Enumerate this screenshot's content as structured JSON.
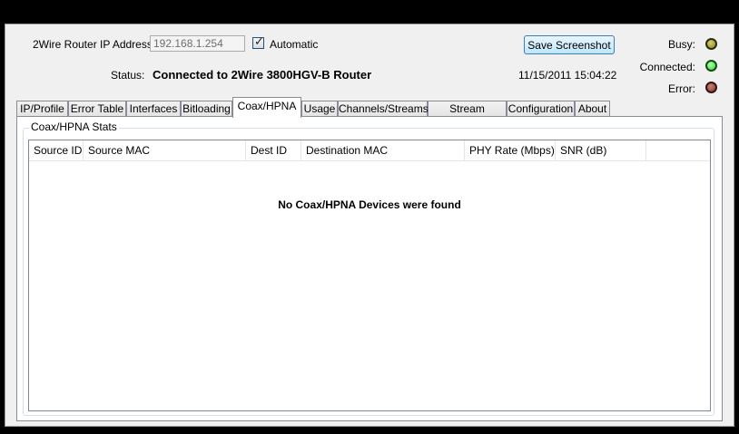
{
  "header": {
    "ip_label": "2Wire Router IP Address:",
    "ip_value": "192.168.1.254",
    "automatic_label": "Automatic",
    "automatic_checked": true,
    "status_label": "Status:",
    "status_text": "Connected to 2Wire 3800HGV-B Router",
    "save_label": "Save Screenshot",
    "timestamp": "11/15/2011 15:04:22"
  },
  "indicators": {
    "busy": {
      "label": "Busy:",
      "color": "#8c8320"
    },
    "connected": {
      "label": "Connected:",
      "color": "#2fd52f"
    },
    "error": {
      "label": "Error:",
      "color": "#7d3a34"
    }
  },
  "tabs": [
    "IP/Profile",
    "Error Table",
    "Interfaces",
    "Bitloading",
    "Coax/HPNA",
    "Usage",
    "Channels/Streams",
    "Stream Analyzer",
    "Configuration",
    "About"
  ],
  "active_tab": "Coax/HPNA",
  "panel": {
    "group_title": "Coax/HPNA Stats",
    "columns": [
      "Source ID",
      "Source MAC",
      "Dest ID",
      "Destination MAC",
      "PHY Rate (Mbps)",
      "SNR (dB)"
    ],
    "empty_message": "No Coax/HPNA Devices were found"
  }
}
